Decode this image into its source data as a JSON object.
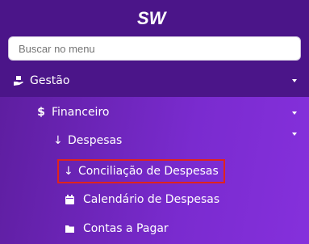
{
  "logo": {
    "text": "SW"
  },
  "search": {
    "placeholder": "Buscar no menu"
  },
  "menu": {
    "gestao": {
      "label": "Gestão",
      "icon": "hand-holding-box-icon"
    },
    "financeiro": {
      "label": "Financeiro",
      "icon": "dollar-icon"
    },
    "despesas": {
      "label": "Despesas",
      "icon": "arrow-down-icon"
    },
    "items": [
      {
        "label": "Conciliação de Despesas",
        "icon": "arrow-down-icon",
        "highlighted": true
      },
      {
        "label": "Calendário de Despesas",
        "icon": "calendar-icon"
      },
      {
        "label": "Contas a Pagar",
        "icon": "folder-icon"
      }
    ]
  },
  "colors": {
    "header_bg": "#4b1589",
    "submenu_gradient_start": "#5e1ea0",
    "submenu_gradient_end": "#8530dc",
    "highlight_border": "#e0241c"
  }
}
